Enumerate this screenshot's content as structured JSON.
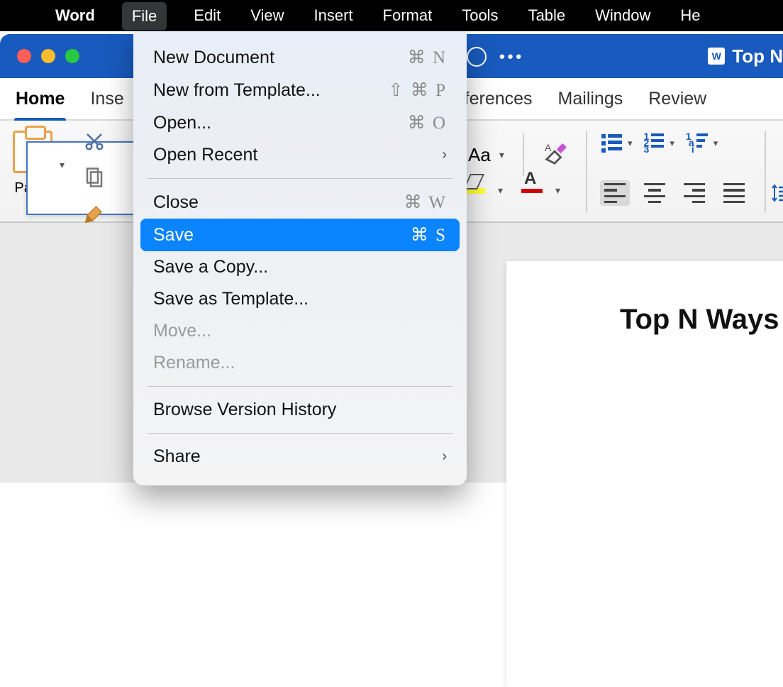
{
  "menubar": {
    "app": "Word",
    "items": [
      "File",
      "Edit",
      "View",
      "Insert",
      "Format",
      "Tools",
      "Table",
      "Window",
      "He"
    ],
    "active": "File"
  },
  "titlebar": {
    "doc_title": "Top N"
  },
  "ribbon": {
    "tabs": {
      "home": "Home",
      "insert_partial": "Inse",
      "references_partial": "eferences",
      "mailings": "Mailings",
      "review": "Review"
    },
    "paste_label": "Paste",
    "font_sample": "Aa"
  },
  "file_menu": {
    "new_document": {
      "label": "New Document",
      "shortcut": "⌘ N"
    },
    "new_from_template": {
      "label": "New from Template...",
      "shortcut": "⇧ ⌘ P"
    },
    "open": {
      "label": "Open...",
      "shortcut": "⌘ O"
    },
    "open_recent": {
      "label": "Open Recent"
    },
    "close": {
      "label": "Close",
      "shortcut": "⌘ W"
    },
    "save": {
      "label": "Save",
      "shortcut": "⌘ S"
    },
    "save_a_copy": {
      "label": "Save a Copy..."
    },
    "save_as_template": {
      "label": "Save as Template..."
    },
    "move": {
      "label": "Move..."
    },
    "rename": {
      "label": "Rename..."
    },
    "browse_history": {
      "label": "Browse Version History"
    },
    "share": {
      "label": "Share"
    }
  },
  "document": {
    "heading": "Top N Ways to Fix"
  }
}
